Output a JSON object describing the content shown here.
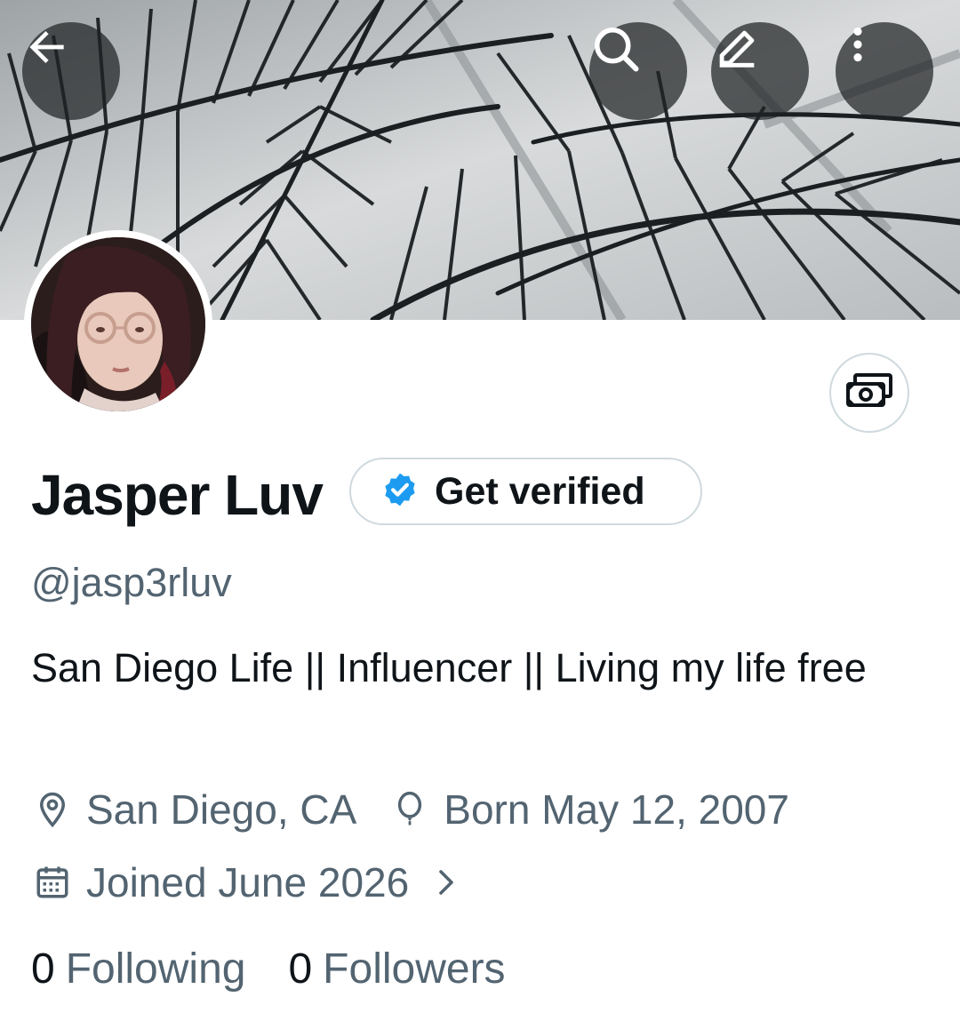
{
  "profile": {
    "display_name": "Jasper Luv",
    "handle": "@jasp3rluv",
    "bio": "San Diego Life || Influencer || Living my life free",
    "location": "San Diego, CA",
    "birthday": "Born May 12, 2007",
    "joined": "Joined June 2026"
  },
  "actions": {
    "get_verified_label": "Get verified"
  },
  "stats": {
    "following_count": "0",
    "following_label": "Following",
    "followers_count": "0",
    "followers_label": "Followers"
  },
  "icons": {
    "back": "arrow-left-icon",
    "search": "search-icon",
    "edit": "pencil-icon",
    "more": "more-vertical-icon",
    "tip": "money-icon",
    "verified": "verified-badge-icon",
    "location": "location-pin-icon",
    "birthday": "balloon-icon",
    "joined": "calendar-icon",
    "joined_more": "chevron-right-icon"
  },
  "colors": {
    "text_primary": "#0f1419",
    "text_secondary": "#536471",
    "verified_blue": "#1d9bf0",
    "border": "#cfd9de"
  }
}
